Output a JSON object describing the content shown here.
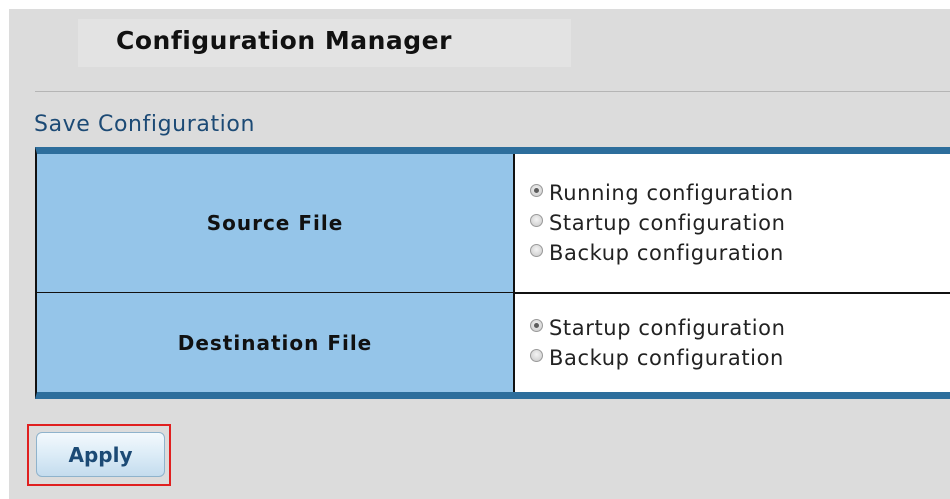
{
  "page": {
    "title": "Configuration Manager"
  },
  "section": {
    "title": "Save Configuration"
  },
  "source": {
    "label": "Source File",
    "options": [
      {
        "label": "Running configuration",
        "checked": true
      },
      {
        "label": "Startup configuration",
        "checked": false
      },
      {
        "label": "Backup configuration",
        "checked": false
      }
    ]
  },
  "destination": {
    "label": "Destination File",
    "options": [
      {
        "label": "Startup configuration",
        "checked": true
      },
      {
        "label": "Backup configuration",
        "checked": false
      }
    ]
  },
  "actions": {
    "apply_label": "Apply"
  },
  "colors": {
    "panel_background": "#dcdcdc",
    "label_cell": "#95c5e9",
    "table_accent": "#2d6e9c",
    "section_title": "#1c4a75",
    "highlight": "#e02020"
  }
}
